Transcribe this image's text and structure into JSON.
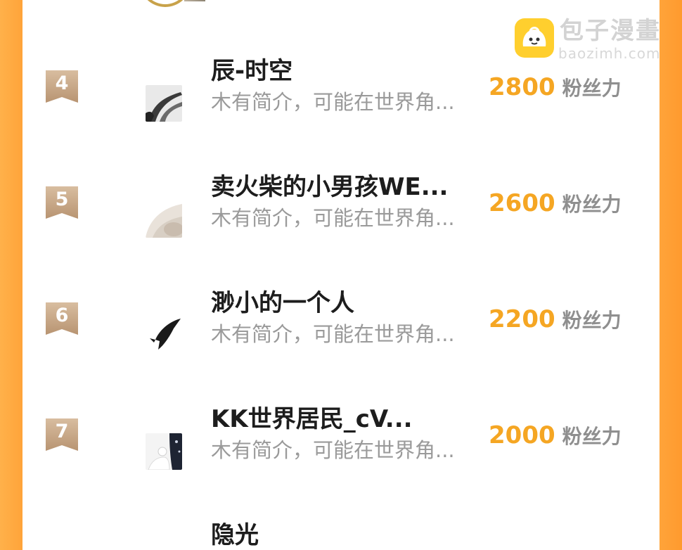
{
  "watermark": {
    "title": "包子漫畫",
    "url": "baozimh.com",
    "logo_icon": "bun-mascot-icon"
  },
  "colors": {
    "accent": "#f5a623",
    "badge": "#c9a98c",
    "frame": "#ffa43a"
  },
  "ranking": [
    {
      "rank": "4",
      "name": "辰-时空",
      "desc": "木有简介，可能在世界角...",
      "score": "2800",
      "unit": "粉丝力",
      "avatar_icon": "ink-sketch-avatar"
    },
    {
      "rank": "5",
      "name": "卖火柴的小男孩WE...",
      "desc": "木有简介，可能在世界角...",
      "score": "2600",
      "unit": "粉丝力",
      "avatar_icon": "pale-blur-avatar"
    },
    {
      "rank": "6",
      "name": "渺小的一个人",
      "desc": "木有简介，可能在世界角...",
      "score": "2200",
      "unit": "粉丝力",
      "avatar_icon": "black-fish-avatar"
    },
    {
      "rank": "7",
      "name": "KK世界居民_cV...",
      "desc": "木有简介，可能在世界角...",
      "score": "2000",
      "unit": "粉丝力",
      "avatar_icon": "night-figure-avatar"
    }
  ],
  "next_partial_name": "隐光"
}
